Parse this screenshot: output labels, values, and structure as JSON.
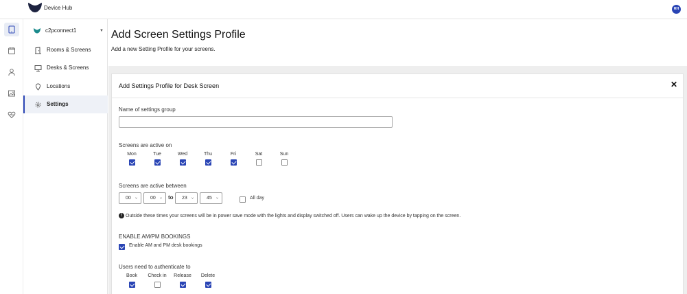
{
  "app": {
    "title": "Device Hub",
    "user_initials": "RH"
  },
  "rail": {
    "icons": [
      "tablet-icon",
      "calendar-icon",
      "person-icon",
      "image-icon",
      "heart-icon"
    ]
  },
  "nav": {
    "org_name": "c2pconnect1",
    "items": [
      {
        "label": "Rooms & Screens"
      },
      {
        "label": "Desks & Screens"
      },
      {
        "label": "Locations"
      },
      {
        "label": "Settings"
      }
    ]
  },
  "header": {
    "title": "Add Screen Settings Profile",
    "subtitle": "Add a new Setting Profile for your screens."
  },
  "card": {
    "title": "Add Settings Profile for Desk Screen",
    "close_symbol": "✕",
    "name_label": "Name of settings group",
    "name_value": "",
    "active_on_label": "Screens are active on",
    "days": [
      {
        "name": "Mon",
        "checked": true
      },
      {
        "name": "Tue",
        "checked": true
      },
      {
        "name": "Wed",
        "checked": true
      },
      {
        "name": "Thu",
        "checked": true
      },
      {
        "name": "Fri",
        "checked": true
      },
      {
        "name": "Sat",
        "checked": false
      },
      {
        "name": "Sun",
        "checked": false
      }
    ],
    "active_between_label": "Screens are active between",
    "start_hour": "00",
    "start_minute": "00",
    "to_label": "to",
    "end_hour": "23",
    "end_minute": "45",
    "all_day_label": "All day",
    "all_day_checked": false,
    "note": "Outside these times your screens will be in power save mode with the lights and display switched off. Users can wake up the device by tapping on the screen.",
    "ampm_heading": "ENABLE AM/PM BOOKINGS",
    "ampm_label": "Enable AM and PM desk bookings",
    "ampm_checked": true,
    "auth_label": "Users need to authenticate to",
    "auth": [
      {
        "name": "Book",
        "checked": true
      },
      {
        "name": "Check in",
        "checked": false
      },
      {
        "name": "Release",
        "checked": true
      },
      {
        "name": "Delete",
        "checked": true
      }
    ]
  },
  "colors": {
    "accent": "#2a45b5",
    "org_logo": "#1a8a8c",
    "band": "#eeeeee"
  }
}
